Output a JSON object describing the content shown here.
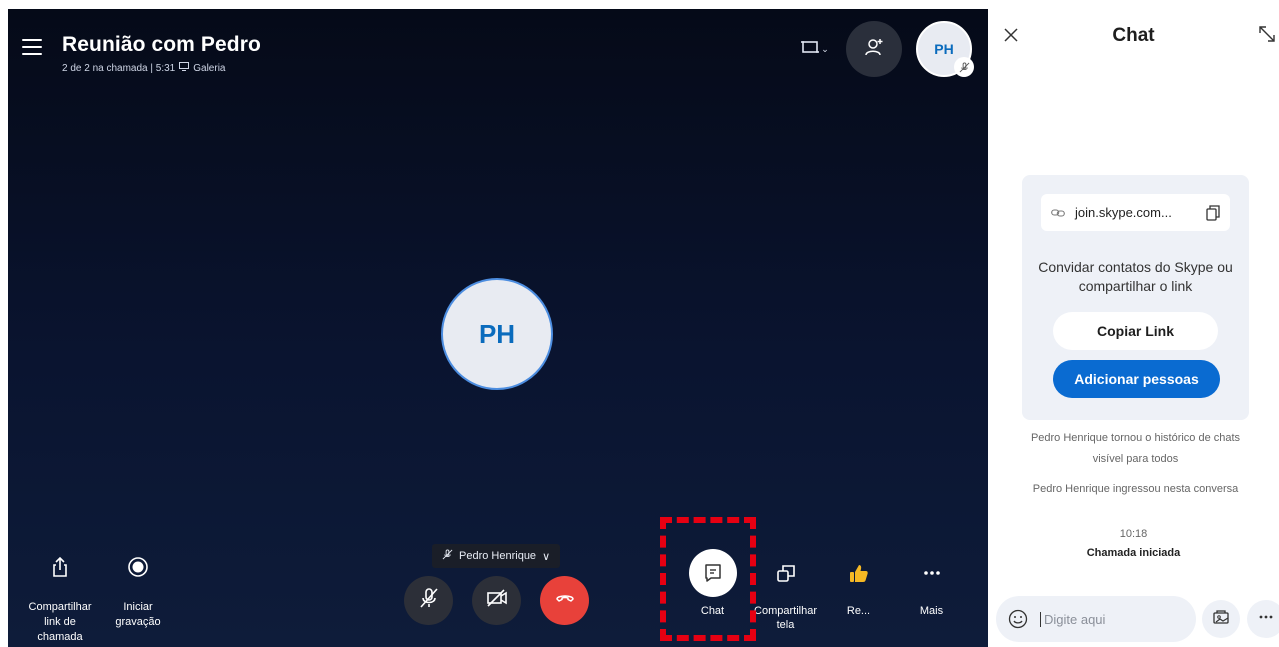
{
  "call": {
    "title": "Reunião com Pedro",
    "status": "2 de 2 na chamada | 5:31",
    "separator": "|",
    "view_mode": "Galeria",
    "layout_caret": "⌄",
    "top_avatar_initials": "PH",
    "center_avatar_initials": "PH",
    "speaker_name": "Pedro Henrique",
    "speaker_caret": "∨"
  },
  "bottom_left": [
    {
      "label": "Compartilhar link de chamada",
      "icon": "share-icon"
    },
    {
      "label": "Iniciar gravação",
      "icon": "record-icon"
    }
  ],
  "bottom_right": [
    {
      "label": "Chat",
      "icon": "chat-icon"
    },
    {
      "label": "Compartilhar tela",
      "icon": "screen-share-icon"
    },
    {
      "label": "Re...",
      "icon": "thumbs-up-icon"
    },
    {
      "label": "Mais",
      "icon": "more-icon"
    }
  ],
  "controls": {
    "mic": "mic-muted-icon",
    "video": "video-off-icon",
    "hangup": "hangup-icon"
  },
  "chat": {
    "title": "Chat",
    "link_text": "join.skype.com...",
    "invite_text": "Convidar contatos do Skype ou compartilhar o link",
    "copy_link": "Copiar Link",
    "add_people": "Adicionar pessoas",
    "msg_history": "Pedro Henrique tornou o histórico de chats visível para todos",
    "msg_joined": "Pedro Henrique ingressou nesta conversa",
    "time": "10:18",
    "call_started": "Chamada iniciada",
    "input_placeholder": "Digite aqui"
  },
  "colors": {
    "accent": "#0a6bd1",
    "hangup": "#e8413a",
    "highlight": "#e60012",
    "call_bg": "#0a1430"
  }
}
